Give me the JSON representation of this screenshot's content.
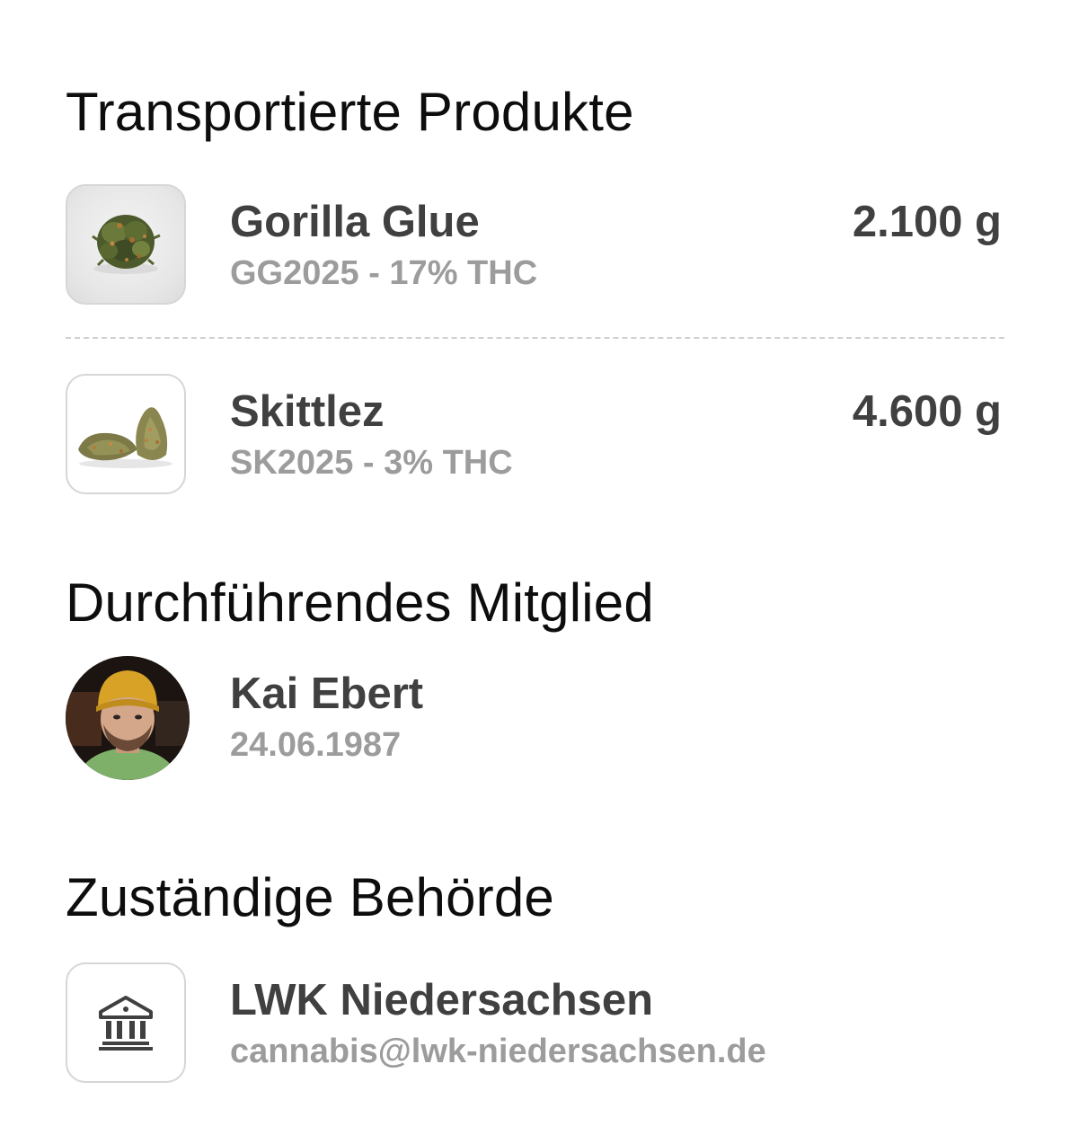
{
  "sections": {
    "products_title": "Transportierte Produkte",
    "member_title": "Durchführendes Mitglied",
    "authority_title": "Zuständige Behörde"
  },
  "products": [
    {
      "name": "Gorilla Glue",
      "detail": "GG2025 - 17% THC",
      "amount": "2.100 g",
      "image": "cannabis-bud-round"
    },
    {
      "name": "Skittlez",
      "detail": "SK2025 - 3% THC",
      "amount": "4.600 g",
      "image": "cannabis-bud-pair"
    }
  ],
  "member": {
    "name": "Kai Ebert",
    "birthdate": "24.06.1987",
    "avatar": "person-photo"
  },
  "authority": {
    "name": "LWK Niedersachsen",
    "email": "cannabis@lwk-niedersachsen.de",
    "icon": "bank-building-icon"
  },
  "colors": {
    "primary_text": "#404040",
    "secondary_text": "#9c9c9c",
    "border": "#d6d6d6",
    "divider": "#cfcfcf"
  }
}
